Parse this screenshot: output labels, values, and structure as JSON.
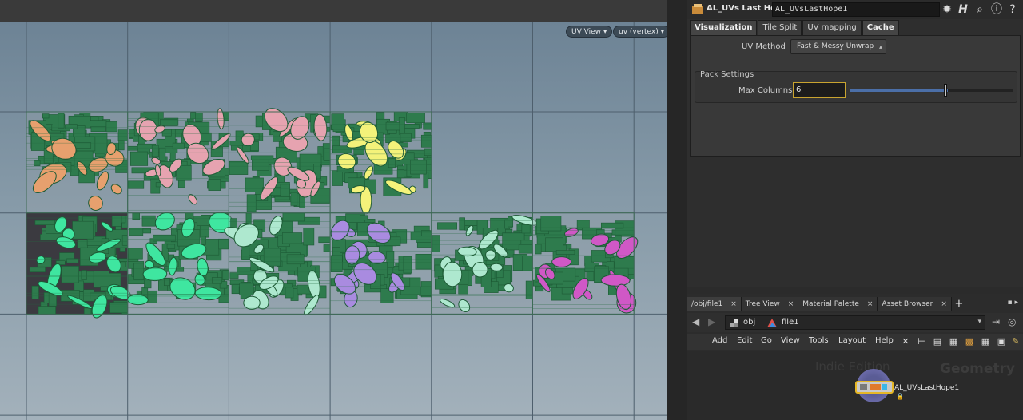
{
  "viewport": {
    "view_button": "UV View",
    "attrib_button": "uv (vertex)",
    "colors": {
      "bg_top": "#6d8395",
      "bg_bottom": "#a3b1bb",
      "grid": "#4e5f6d",
      "island_green": "#2e7b4d",
      "peach": "#e7a06e",
      "pink": "#e6a3b0",
      "yellow": "#f4f27a",
      "mint": "#3fe6a0",
      "aqua": "#aee8cf",
      "lavender": "#a98be0",
      "magenta": "#d058c6"
    }
  },
  "param_pane": {
    "node_type": "AL_UVs Last Hope",
    "node_name": "AL_UVsLastHope1",
    "header_icons": [
      "gear-icon",
      "help-h-icon",
      "search-icon",
      "info-icon",
      "question-icon"
    ],
    "tabs": [
      {
        "label": "Visualization",
        "active": true
      },
      {
        "label": "Tile Split",
        "active": false
      },
      {
        "label": "UV mapping",
        "active": false
      },
      {
        "label": "Cache",
        "active": true
      }
    ],
    "uv_method_label": "UV Method",
    "uv_method_value": "Fast & Messy Unwrap",
    "pack_settings_label": "Pack Settings",
    "max_columns_label": "Max Columns",
    "max_columns_value": "6",
    "max_columns_slider_fraction": 0.6
  },
  "network": {
    "tabs": [
      {
        "label": "/obj/file1",
        "close": "×"
      },
      {
        "label": "Tree View",
        "close": "×"
      },
      {
        "label": "Material Palette",
        "close": "×"
      },
      {
        "label": "Asset Browser",
        "close": "×"
      }
    ],
    "add_tab": "+",
    "path": {
      "crumb_obj": "obj",
      "crumb_file": "file1"
    },
    "menu": [
      "Add",
      "Edit",
      "Go",
      "View",
      "Tools",
      "Layout",
      "Help"
    ],
    "watermark_left": "Indie Edition",
    "watermark_right": "Geometry",
    "node_label": "AL_UVsLastHope1"
  }
}
